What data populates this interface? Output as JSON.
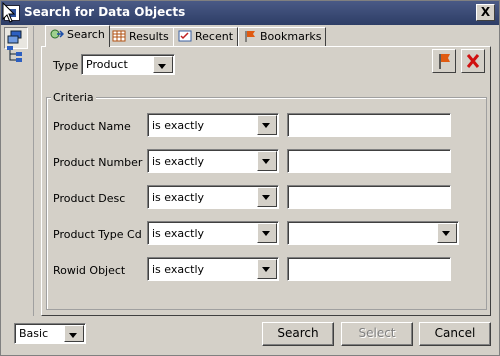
{
  "window": {
    "title": "Search for Data Objects",
    "close_label": "X"
  },
  "tabs": [
    {
      "label": "Search",
      "icon": "search-arrow-icon"
    },
    {
      "label": "Results",
      "icon": "grid-icon"
    },
    {
      "label": "Recent",
      "icon": "checklist-icon"
    },
    {
      "label": "Bookmarks",
      "icon": "flag-icon"
    }
  ],
  "type_label": "Type",
  "type_value": "Product",
  "criteria": {
    "title": "Criteria",
    "rows": [
      {
        "label": "Product Name",
        "operator": "is exactly",
        "value": "",
        "value_is_dropdown": false
      },
      {
        "label": "Product Number",
        "operator": "is exactly",
        "value": "",
        "value_is_dropdown": false
      },
      {
        "label": "Product Desc",
        "operator": "is exactly",
        "value": "",
        "value_is_dropdown": false
      },
      {
        "label": "Product Type Cd",
        "operator": "is exactly",
        "value": "",
        "value_is_dropdown": true
      },
      {
        "label": "Rowid Object",
        "operator": "is exactly",
        "value": "",
        "value_is_dropdown": false
      }
    ]
  },
  "mode_value": "Basic",
  "buttons": {
    "search": "Search",
    "select": "Select",
    "cancel": "Cancel"
  },
  "colors": {
    "titlebar": "#34446f",
    "face": "#d4d0c8",
    "accent_flag": "#e05a10",
    "clear_x": "#d01010"
  }
}
